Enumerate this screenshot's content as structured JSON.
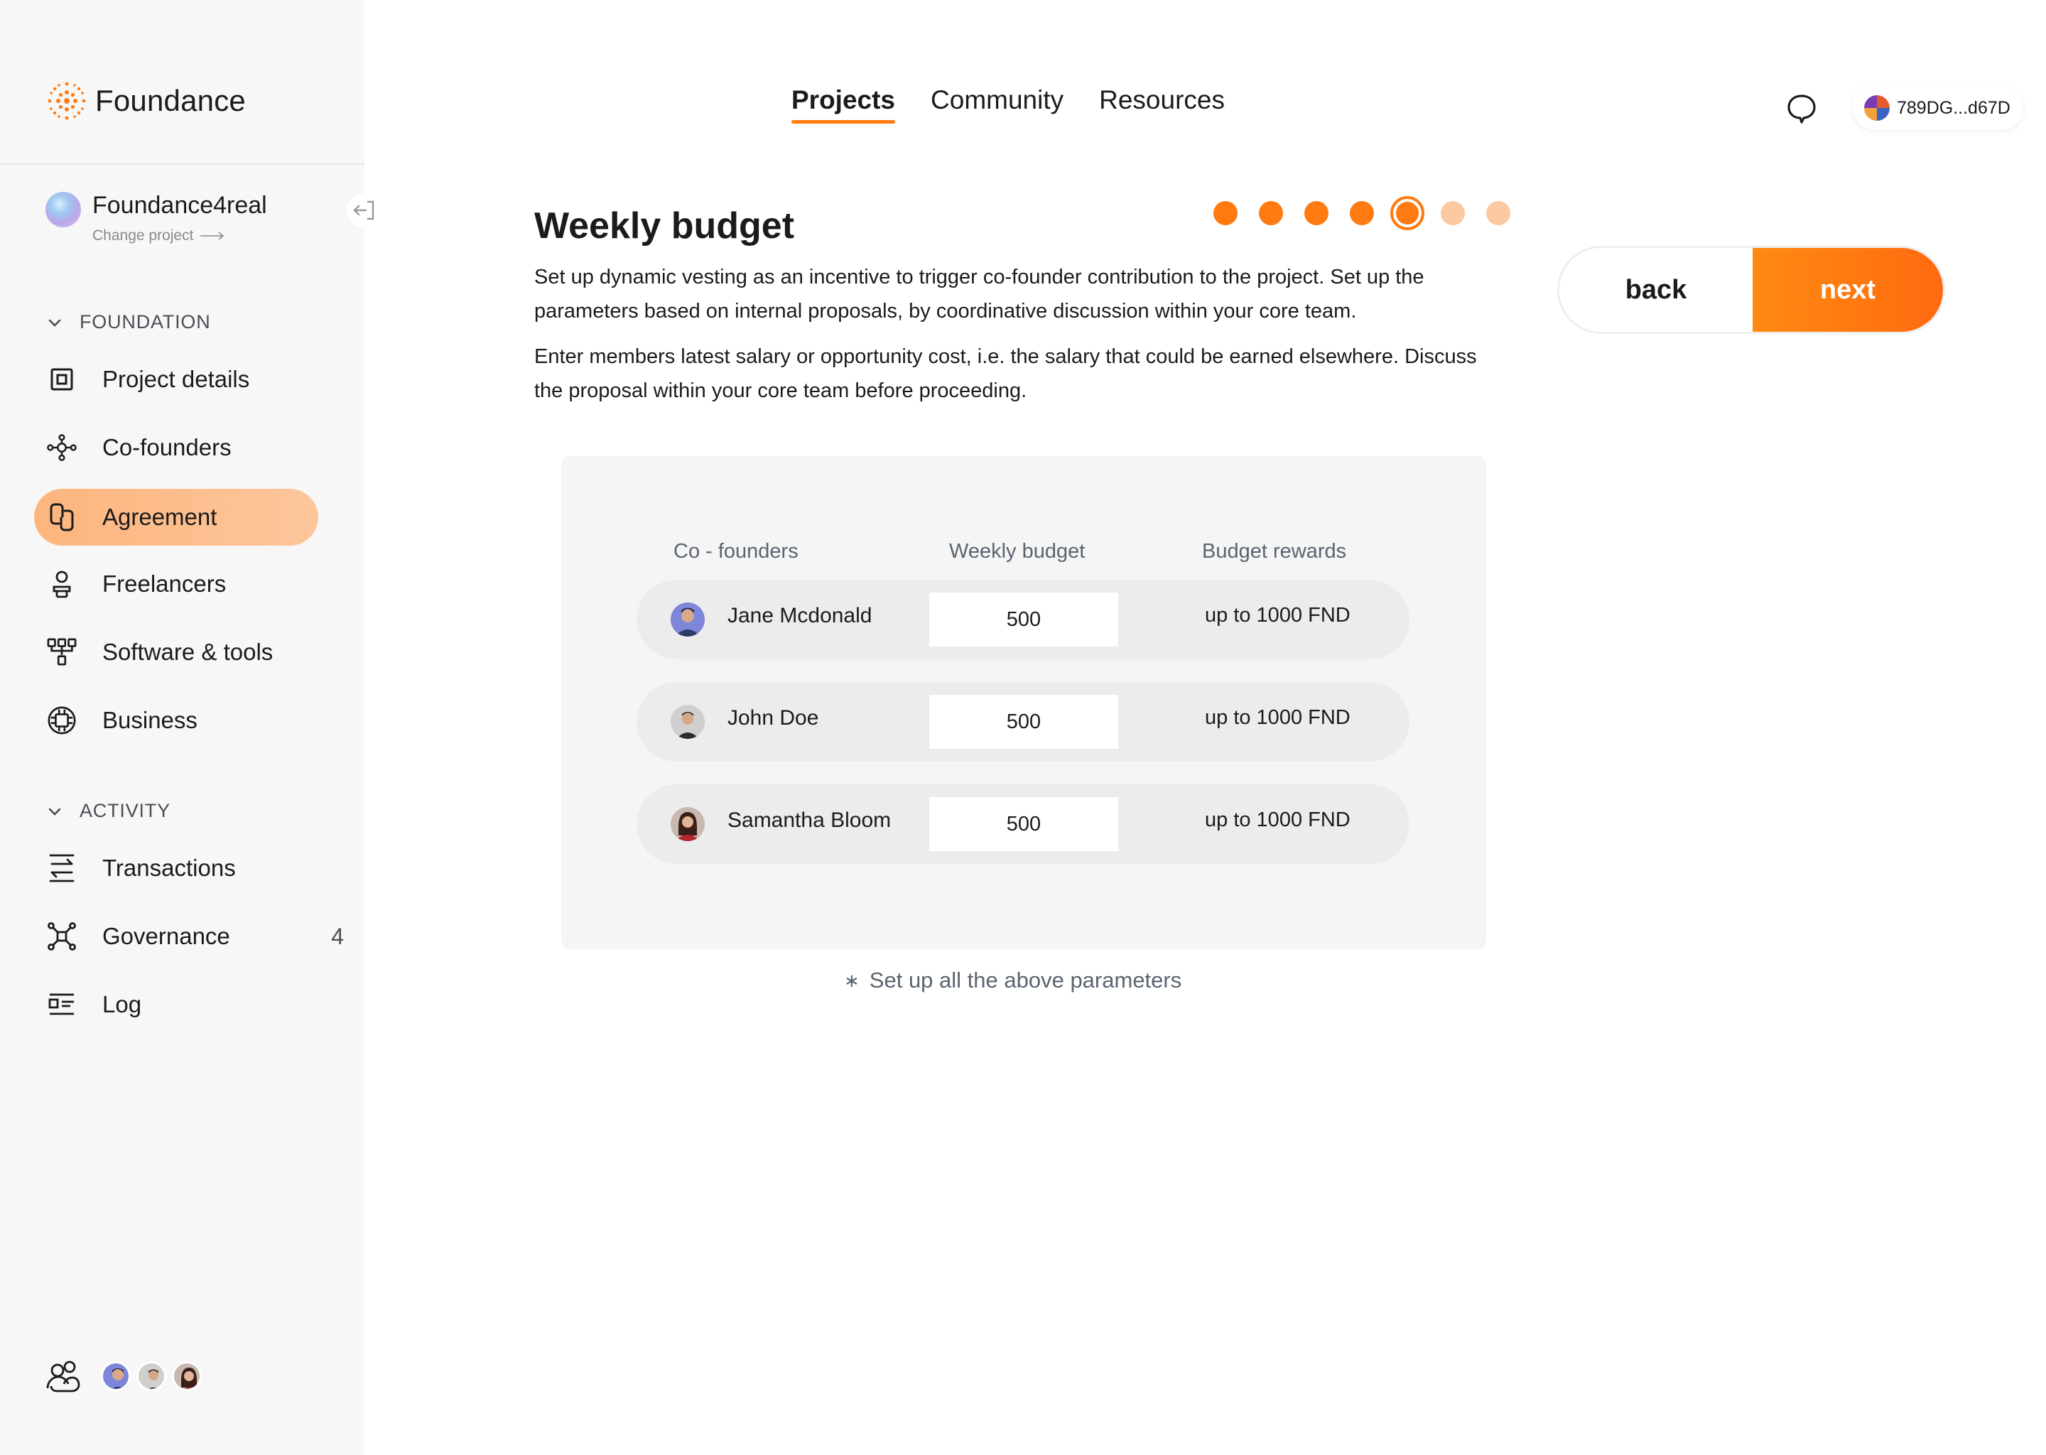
{
  "brand": {
    "name": "Foundance",
    "accent": "#ff7a10"
  },
  "project": {
    "name": "Foundance4real",
    "change_label": "Change project"
  },
  "sidebar": {
    "sections": [
      {
        "title": "FOUNDATION"
      },
      {
        "title": "ACTIVITY"
      }
    ],
    "foundation_items": [
      {
        "label": "Project details",
        "icon": "square-icon"
      },
      {
        "label": "Co-founders",
        "icon": "nodes-icon"
      },
      {
        "label": "Agreement",
        "icon": "link-icon",
        "active": true
      },
      {
        "label": "Freelancers",
        "icon": "person-icon"
      },
      {
        "label": "Software & tools",
        "icon": "tree-icon"
      },
      {
        "label": "Business",
        "icon": "chip-icon"
      }
    ],
    "activity_items": [
      {
        "label": "Transactions",
        "icon": "transfer-icon"
      },
      {
        "label": "Governance",
        "icon": "network-icon",
        "badge": "4"
      },
      {
        "label": "Log",
        "icon": "list-icon"
      }
    ]
  },
  "topnav": {
    "tabs": [
      "Projects",
      "Community",
      "Resources"
    ],
    "active": "Projects"
  },
  "wallet": {
    "address": "789DG...d67D"
  },
  "page": {
    "title": "Weekly budget",
    "paragraph1": "Set up dynamic vesting as an incentive to trigger co-founder contribution to the project. Set up the parameters based on internal proposals, by coordinative discussion within your core team.",
    "paragraph2": "Enter members latest salary or opportunity cost, i.e. the salary that could be earned elsewhere. Discuss the proposal within your core team before proceeding.",
    "steps_total": 7,
    "current_step": 5,
    "back_label": "back",
    "next_label": "next"
  },
  "table": {
    "headers": [
      "Co - founders",
      "Weekly budget",
      "Budget rewards"
    ],
    "rows": [
      {
        "name": "Jane Mcdonald",
        "budget": "500",
        "reward": "up to 1000  FND"
      },
      {
        "name": "John Doe",
        "budget": "500",
        "reward": "up to 1000  FND"
      },
      {
        "name": "Samantha Bloom",
        "budget": "500",
        "reward": "up to 1000  FND"
      }
    ]
  },
  "hint": "Set up all the above parameters"
}
